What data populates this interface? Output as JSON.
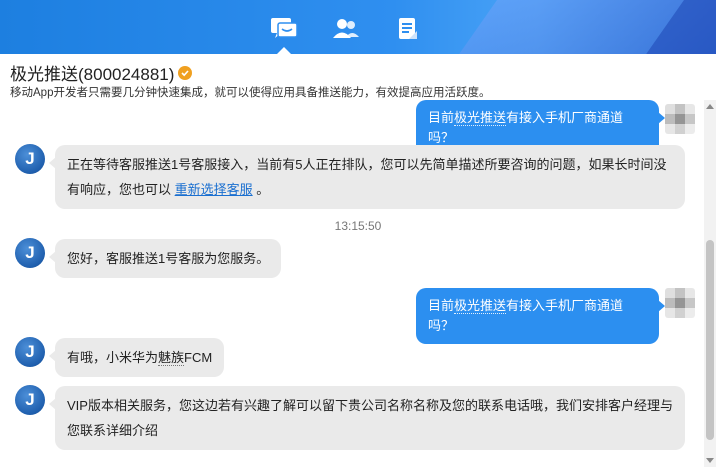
{
  "header": {
    "tabs": [
      {
        "name": "chat",
        "icon": "chat-bubble-icon",
        "active": true
      },
      {
        "name": "contacts",
        "icon": "contacts-icon",
        "active": false
      },
      {
        "name": "documents",
        "icon": "document-icon",
        "active": false
      }
    ],
    "accent_color": "#2f8ff0"
  },
  "info": {
    "title": "极光推送(800024881)",
    "verified_icon": "verified-badge-icon",
    "subtitle": "移动App开发者只需要几分钟快速集成，就可以使得应用具备推送能力，有效提高应用活跃度。"
  },
  "messages": {
    "m1": {
      "sender": "user",
      "text": "目前极光推送有接入手机厂商通道吗？"
    },
    "m2": {
      "sender": "agent",
      "text_line1": "正在等待客服推送1号客服接入，当前有5人正在排队，您可以先简单描述所要咨询的问题，如果长时间没",
      "text_line2_prefix": "有响应，您也可以 ",
      "link": "重新选择客服",
      "text_line2_suffix": " 。"
    },
    "timestamp": "13:15:50",
    "m3": {
      "sender": "agent",
      "text": "您好，客服推送1号客服为您服务。"
    },
    "m4": {
      "sender": "user",
      "text": "目前极光推送有接入手机厂商通道吗？"
    },
    "m5": {
      "sender": "agent",
      "text": "有哦，小米华为魅族FCM"
    },
    "m6": {
      "sender": "agent",
      "text_line1": "VIP版本相关服务，您这边若有兴趣了解可以留下贵公司名称名称及您的联系电话哦，我们安排客户经理与",
      "text_line2": "您联系详细介绍"
    }
  },
  "colors": {
    "outgoing_bubble": "#2c8ff0",
    "incoming_bubble": "#eaeaea",
    "link": "#1a6fd0"
  }
}
